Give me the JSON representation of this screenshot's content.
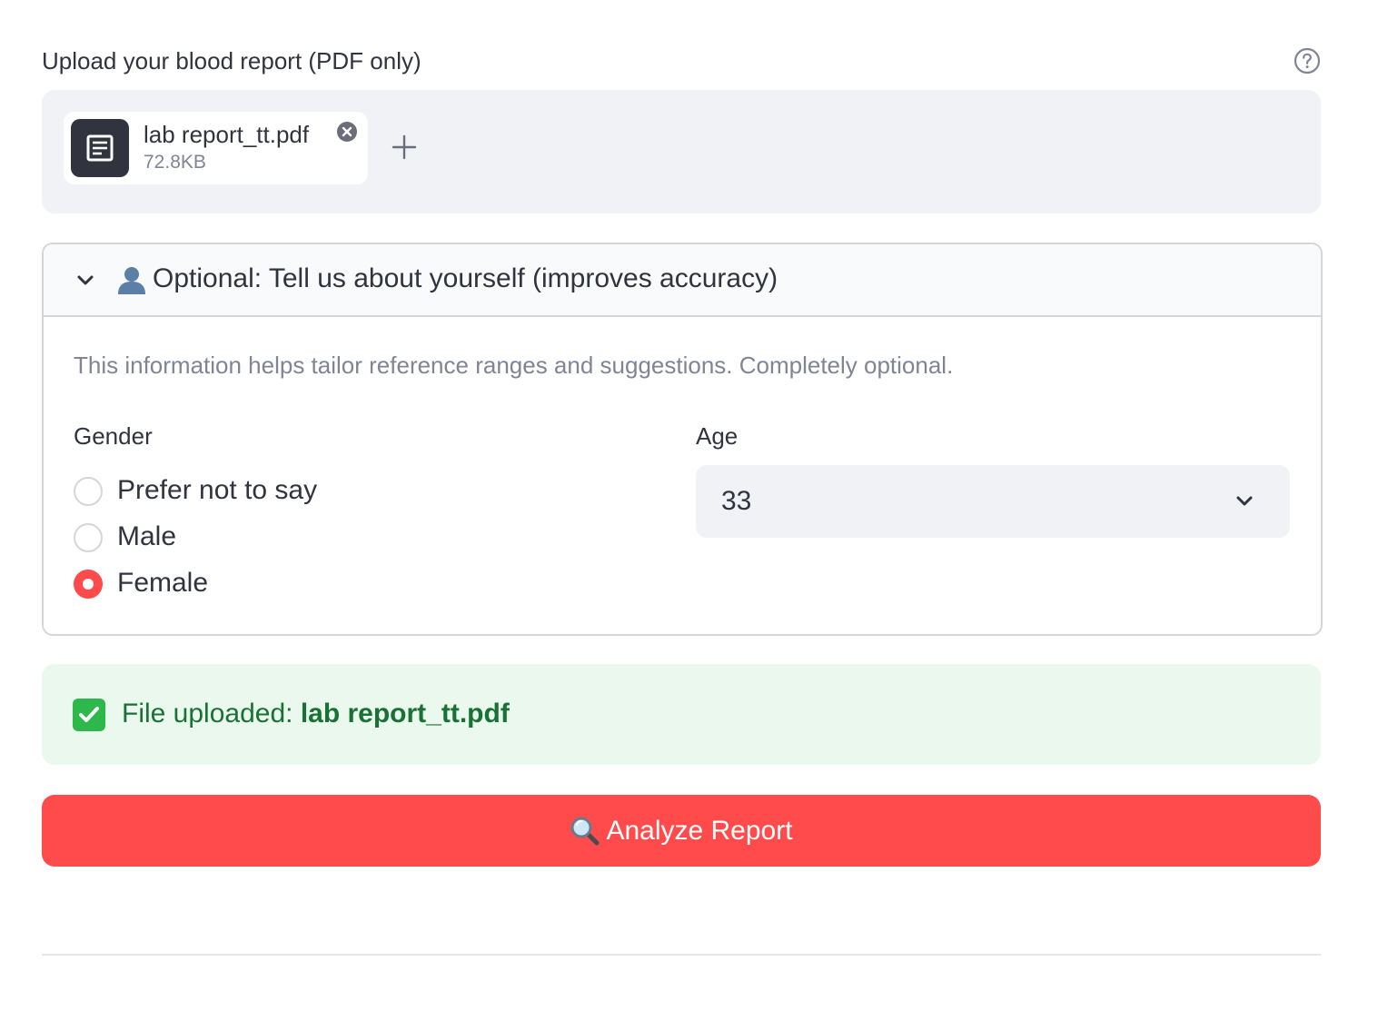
{
  "uploader": {
    "label": "Upload your blood report (PDF only)",
    "file": {
      "name": "lab report_tt.pdf",
      "size": "72.8KB"
    },
    "icons": {
      "help": "help-circle-icon",
      "file": "document-icon",
      "remove": "close-circle-icon",
      "add": "plus-icon"
    }
  },
  "expander": {
    "title": "Optional: Tell us about yourself (improves accuracy)",
    "expanded": true,
    "icon": "person-icon",
    "caption": "This information helps tailor reference ranges and suggestions. Completely optional.",
    "gender": {
      "label": "Gender",
      "options": [
        "Prefer not to say",
        "Male",
        "Female"
      ],
      "selected": "Female"
    },
    "age": {
      "label": "Age",
      "value": "33"
    }
  },
  "status": {
    "prefix": "File uploaded:",
    "filename": "lab report_tt.pdf",
    "icon": "check-box-icon"
  },
  "actions": {
    "analyze_label": "Analyze Report",
    "analyze_icon": "magnifier-icon"
  },
  "colors": {
    "primary": "#ff4b4b",
    "success_bg": "#ebf8ee",
    "success_text": "#177233",
    "input_bg": "#f0f2f6",
    "text": "#31333f",
    "muted": "#808495"
  }
}
